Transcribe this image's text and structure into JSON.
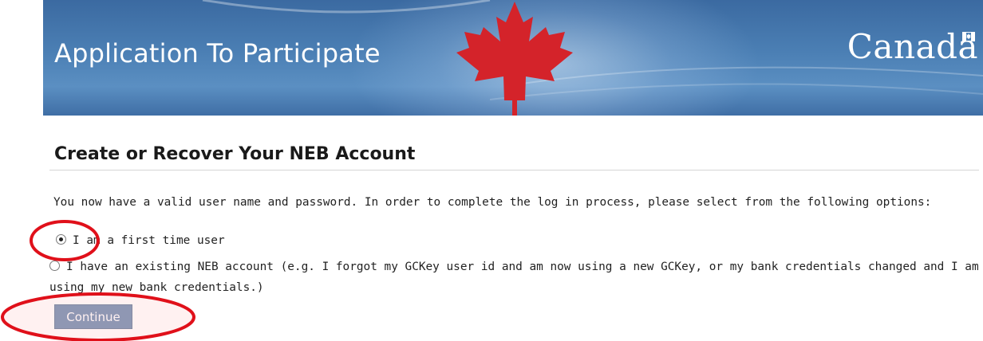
{
  "banner": {
    "title": "Application To Participate",
    "wordmark": "Canada",
    "colors": {
      "sky": "#4b7fb4",
      "leaf": "#d4232a"
    }
  },
  "main": {
    "heading": "Create or Recover Your NEB Account",
    "intro": "You now have a valid user name and password. In order to complete the log in process, please select from the following options:",
    "options": [
      {
        "label": "I am a first time user",
        "selected": true
      },
      {
        "label": "I have an existing NEB account (e.g. I forgot my GCKey user id and am now using a new GCKey, or my bank credentials changed and I am using my new bank credentials.)",
        "selected": false
      }
    ],
    "continue_label": "Continue"
  },
  "annotations": {
    "color": "#e0101a"
  }
}
